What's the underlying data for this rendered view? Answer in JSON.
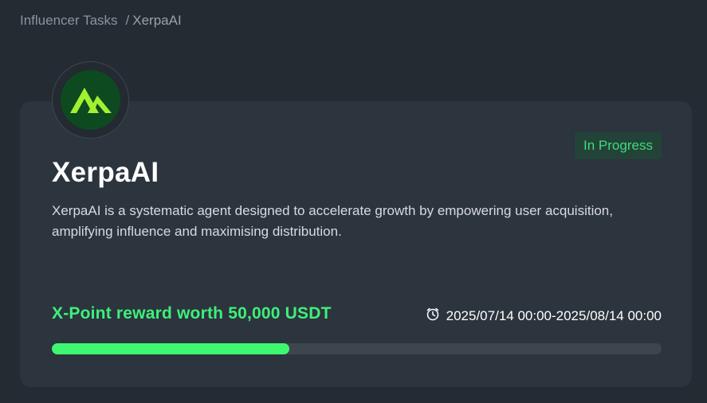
{
  "breadcrumb": {
    "parent": "Influencer Tasks",
    "separator": "/",
    "current": "XerpaAI"
  },
  "project": {
    "logo_icon": "xerpa-logo-icon",
    "name": "XerpaAI",
    "status": "In Progress",
    "description": "XerpaAI is a systematic agent designed to accelerate growth by empowering user acquisition, amplifying influence and maximising distribution.",
    "reward": "X-Point reward worth 50,000 USDT",
    "date_range": "2025/07/14 00:00-2025/08/14 00:00",
    "clock_icon": "clock-icon",
    "progress": 0.39
  },
  "colors": {
    "background": "#252b33",
    "card": "#2c343e",
    "accent_green": "#3ef079",
    "status_bg": "#234338",
    "status_text": "#3ddc7b",
    "logo_bg": "#0e4a1f",
    "logo_mark": "#a3f032"
  }
}
